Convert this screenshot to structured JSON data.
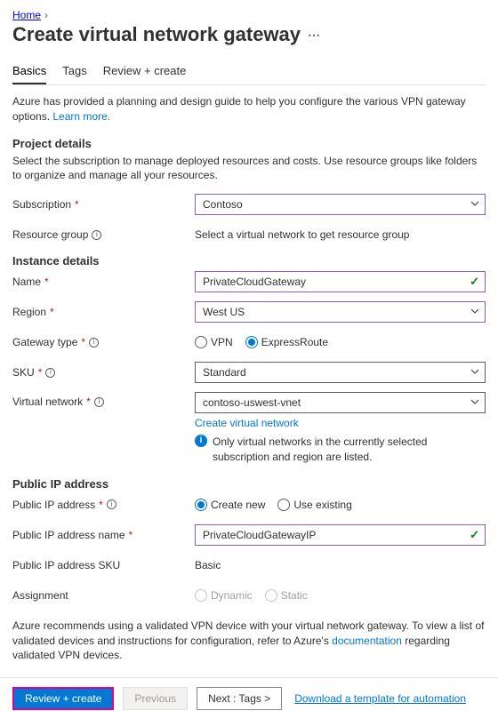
{
  "breadcrumb": {
    "home": "Home"
  },
  "page_title": "Create virtual network gateway",
  "tabs": {
    "basics": "Basics",
    "tags": "Tags",
    "review": "Review + create"
  },
  "intro": {
    "text": "Azure has provided a planning and design guide to help you configure the various VPN gateway options. ",
    "learn_more": "Learn more."
  },
  "project": {
    "title": "Project details",
    "desc": "Select the subscription to manage deployed resources and costs. Use resource groups like folders to organize and manage all your resources.",
    "subscription_label": "Subscription",
    "subscription_value": "Contoso",
    "rg_label": "Resource group",
    "rg_text": "Select a virtual network to get resource group"
  },
  "instance": {
    "title": "Instance details",
    "name_label": "Name",
    "name_value": "PrivateCloudGateway",
    "region_label": "Region",
    "region_value": "West US",
    "gwtype_label": "Gateway type",
    "gwtype_vpn": "VPN",
    "gwtype_er": "ExpressRoute",
    "sku_label": "SKU",
    "sku_value": "Standard",
    "vnet_label": "Virtual network",
    "vnet_value": "contoso-uswest-vnet",
    "vnet_create": "Create virtual network",
    "vnet_note": "Only virtual networks in the currently selected subscription and region are listed."
  },
  "publicip": {
    "title": "Public IP address",
    "addr_label": "Public IP address",
    "addr_createnew": "Create new",
    "addr_useexisting": "Use existing",
    "name_label": "Public IP address name",
    "name_value": "PrivateCloudGatewayIP",
    "sku_label": "Public IP address SKU",
    "sku_value": "Basic",
    "assign_label": "Assignment",
    "assign_dynamic": "Dynamic",
    "assign_static": "Static"
  },
  "footer_note": {
    "pre": "Azure recommends using a validated VPN device with your virtual network gateway. To view a list of validated devices and instructions for configuration, refer to Azure's ",
    "link": "documentation",
    "post": " regarding validated VPN devices."
  },
  "buttons": {
    "review": "Review + create",
    "previous": "Previous",
    "next": "Next : Tags >",
    "download": "Download a template for automation"
  }
}
